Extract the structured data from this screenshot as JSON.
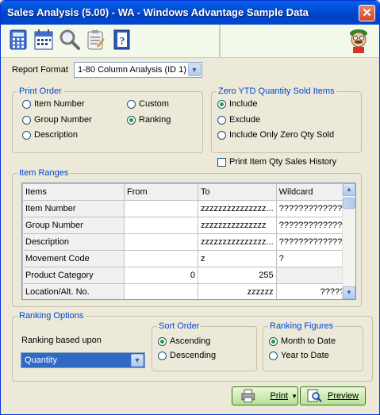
{
  "window": {
    "title": "Sales Analysis (5.00) - WA - Windows Advantage Sample Data",
    "close_glyph": "✕"
  },
  "toolbar": {
    "icons": [
      "calculator-icon",
      "calendar-icon",
      "magnifier-icon",
      "clipboard-icon",
      "help-book-icon"
    ]
  },
  "report_format": {
    "label": "Report Format",
    "value": "1-80 Column Analysis (ID 1)"
  },
  "print_order": {
    "title": "Print Order",
    "options": [
      "Item Number",
      "Group Number",
      "Description",
      "Custom",
      "Ranking"
    ],
    "selected": "Ranking"
  },
  "zero_ytd": {
    "title": "Zero YTD Quantity Sold Items",
    "options": [
      "Include",
      "Exclude",
      "Include Only Zero Qty Sold"
    ],
    "selected": "Include"
  },
  "print_history": {
    "label": "Print Item Qty Sales History",
    "checked": false
  },
  "item_ranges": {
    "title": "Item Ranges",
    "columns": [
      "Items",
      "From",
      "To",
      "Wildcard"
    ],
    "rows": [
      {
        "name": "Item Number",
        "from": "",
        "to": "zzzzzzzzzzzzzzz...",
        "wildcard": "?????????????..."
      },
      {
        "name": "Group Number",
        "from": "",
        "to": "zzzzzzzzzzzzzzz",
        "wildcard": "?????????????..."
      },
      {
        "name": "Description",
        "from": "",
        "to": "zzzzzzzzzzzzzzz...",
        "wildcard": "?????????????..."
      },
      {
        "name": "Movement Code",
        "from": "",
        "to": "z",
        "wildcard": "?"
      },
      {
        "name": "Product Category",
        "from": "0",
        "to": "255",
        "wildcard": ""
      },
      {
        "name": "Location/Alt. No.",
        "from": "",
        "to": "zzzzzz",
        "wildcard": "??????"
      }
    ]
  },
  "ranking_options": {
    "title": "Ranking Options",
    "based_upon_label": "Ranking based upon",
    "based_upon_value": "Quantity",
    "sort_order": {
      "title": "Sort Order",
      "options": [
        "Ascending",
        "Descending"
      ],
      "selected": "Ascending"
    },
    "ranking_figures": {
      "title": "Ranking Figures",
      "options": [
        "Month to Date",
        "Year to Date"
      ],
      "selected": "Month to Date"
    }
  },
  "buttons": {
    "print": "Print",
    "preview": "Preview"
  },
  "colors": {
    "title_bar": "#0054E3",
    "group_title": "#0046D5",
    "radio_on": "#21A121",
    "button_green": "#B8E098"
  }
}
